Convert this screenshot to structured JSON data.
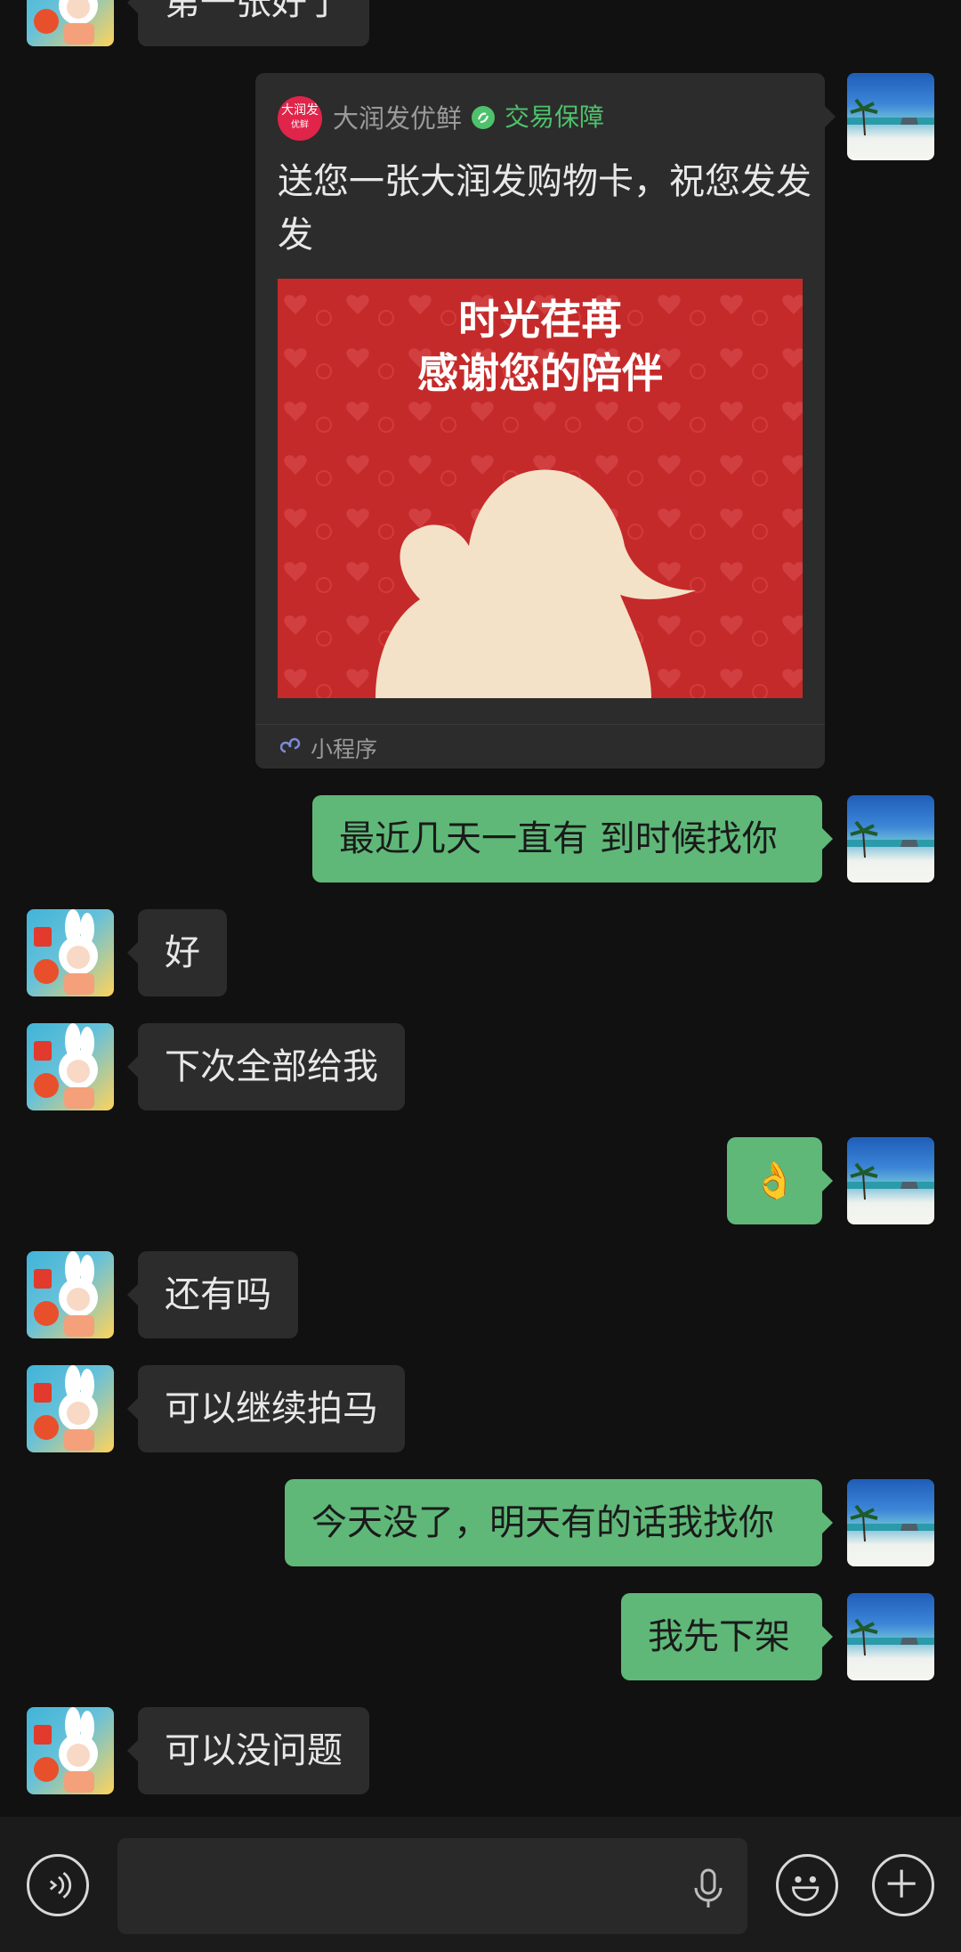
{
  "chat": {
    "top_partial_message": "第一张好了",
    "card": {
      "brand": "大润发优鲜",
      "logo_text_line1": "大润发",
      "logo_text_line2": "优鲜",
      "verify_label": "交易保障",
      "text": "送您一张大润发购物卡，祝您发发发",
      "image_line1": "时光荏苒",
      "image_line2": "感谢您的陪伴",
      "footer": "小程序"
    },
    "messages": [
      {
        "side": "out",
        "text": "最近几天一直有 到时候找你"
      },
      {
        "side": "in",
        "text": "好"
      },
      {
        "side": "in",
        "text": "下次全部给我"
      },
      {
        "side": "out",
        "text": "👌"
      },
      {
        "side": "in",
        "text": "还有吗"
      },
      {
        "side": "in",
        "text": "可以继续拍马"
      },
      {
        "side": "out",
        "text": "今天没了，明天有的话我找你"
      },
      {
        "side": "out",
        "text": "我先下架"
      },
      {
        "side": "in",
        "text": "可以没问题"
      }
    ]
  },
  "input_bar": {
    "voice_icon": "voice-toggle-icon",
    "mic_icon": "microphone-icon",
    "emoji_icon": "emoji-icon",
    "plus_icon": "plus-icon"
  },
  "colors": {
    "background": "#111111",
    "bubble_in": "#2c2c2c",
    "bubble_out": "#5fb878",
    "verify_green": "#4ec16b"
  }
}
